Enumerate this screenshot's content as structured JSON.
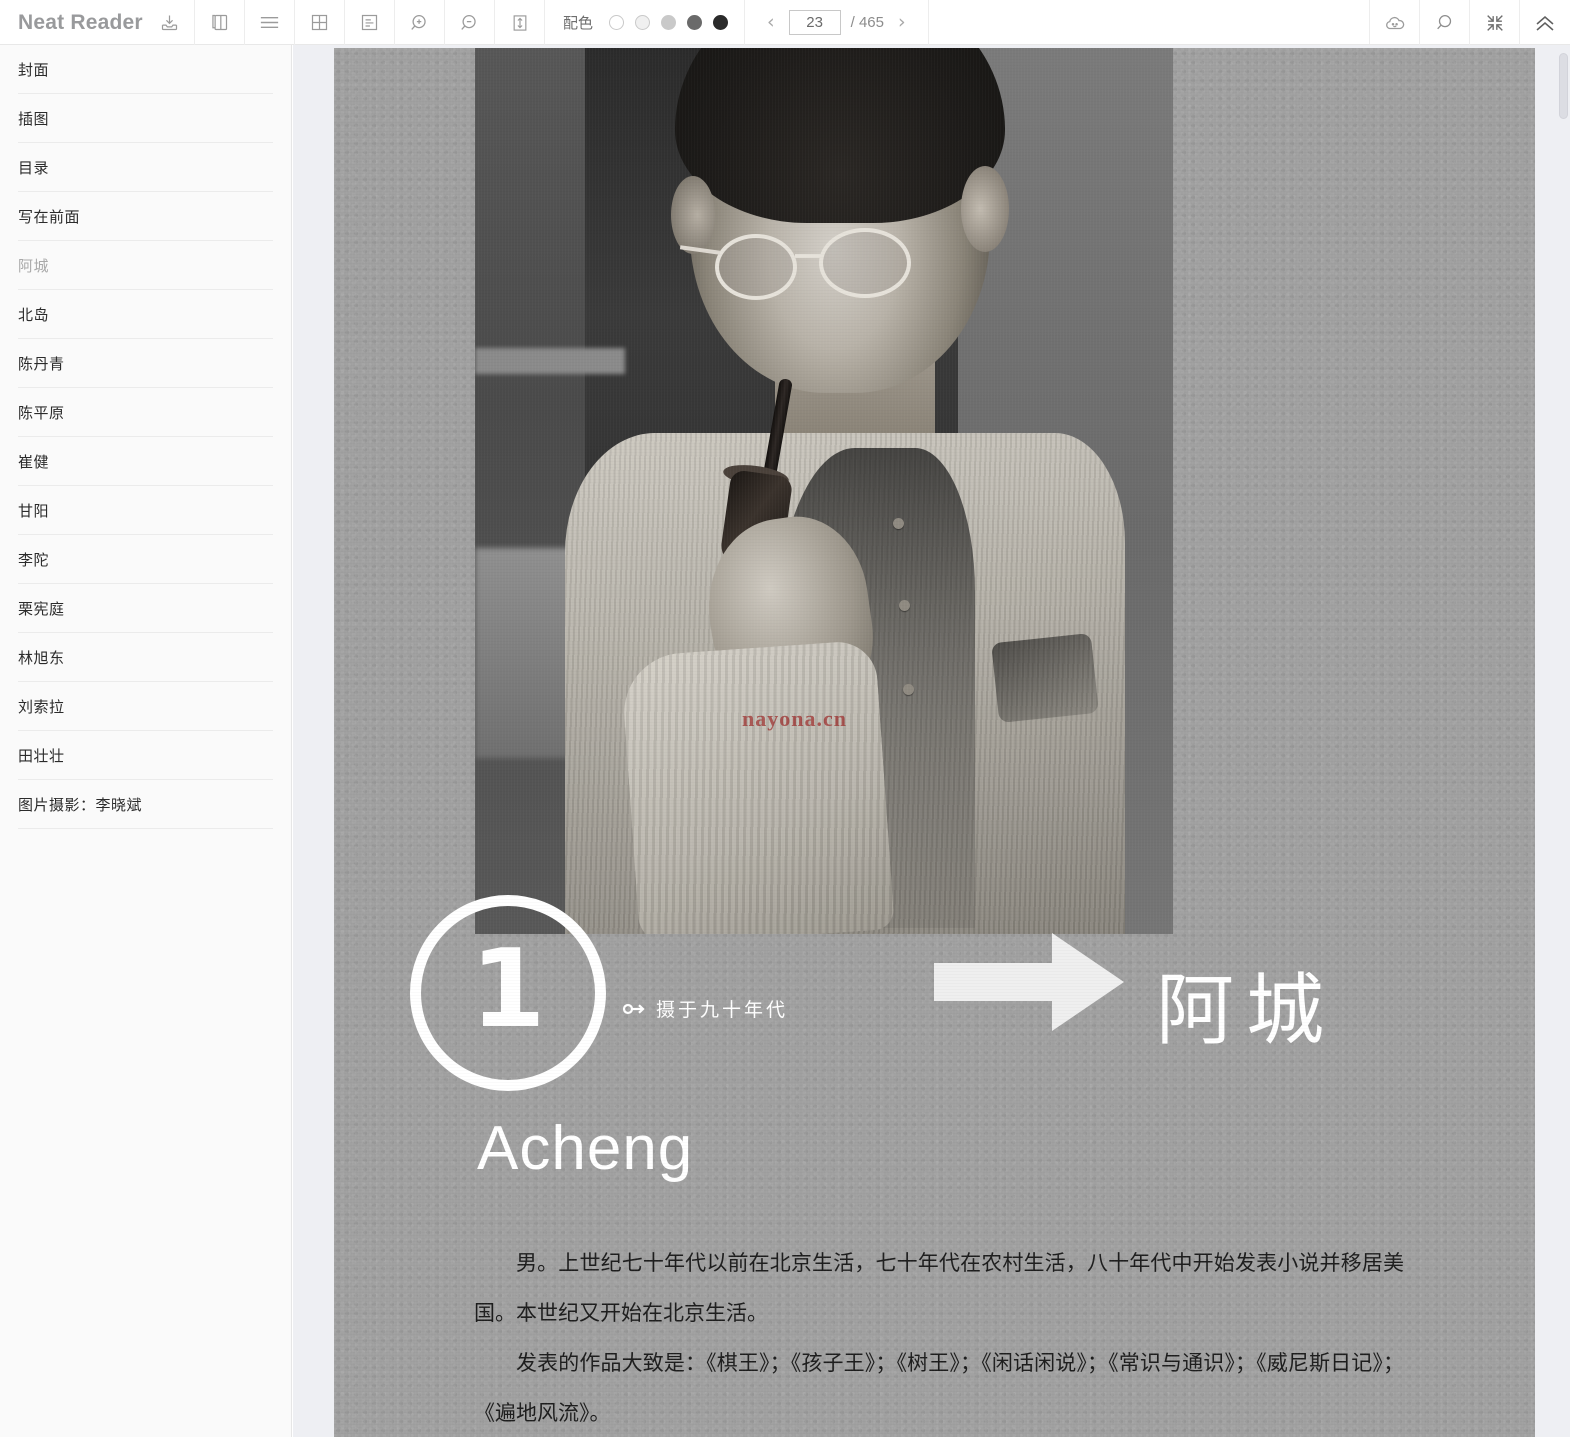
{
  "app": {
    "name": "Neat Reader"
  },
  "toolbar": {
    "icons": [
      {
        "name": "import-icon",
        "title": "import"
      },
      {
        "name": "duplicate-page-icon",
        "title": "two-page"
      },
      {
        "name": "hamburger-menu-icon",
        "title": "menu"
      },
      {
        "name": "grid-layout-icon",
        "title": "grid"
      },
      {
        "name": "text-layout-icon",
        "title": "text layout"
      },
      {
        "name": "zoom-in-icon",
        "title": "zoom in"
      },
      {
        "name": "zoom-out-icon",
        "title": "zoom out"
      },
      {
        "name": "fit-height-icon",
        "title": "fit height"
      }
    ],
    "palette": {
      "label": "配色",
      "swatches": [
        "#ffffff",
        "#f0f0f0",
        "#c9c9c9",
        "#6a6a6a",
        "#2b2b2b"
      ],
      "selected_index": 0
    },
    "pager": {
      "prev_label": "‹",
      "next_label": "›",
      "current_page": "23",
      "total_label": "/ 465",
      "total_pages": 465
    },
    "right_icons": [
      {
        "name": "cloud-icon",
        "title": "cloud sync"
      },
      {
        "name": "search-icon",
        "title": "search"
      },
      {
        "name": "collapse-icon",
        "title": "collapse"
      },
      {
        "name": "chevron-double-up-icon",
        "title": "scroll to top"
      }
    ]
  },
  "sidebar": {
    "items": [
      {
        "label": "封面",
        "active": false
      },
      {
        "label": "插图",
        "active": false
      },
      {
        "label": "目录",
        "active": false
      },
      {
        "label": "写在前面",
        "active": false
      },
      {
        "label": "阿城",
        "active": true
      },
      {
        "label": "北岛",
        "active": false
      },
      {
        "label": "陈丹青",
        "active": false
      },
      {
        "label": "陈平原",
        "active": false
      },
      {
        "label": "崔健",
        "active": false
      },
      {
        "label": "甘阳",
        "active": false
      },
      {
        "label": "李陀",
        "active": false
      },
      {
        "label": "栗宪庭",
        "active": false
      },
      {
        "label": "林旭东",
        "active": false
      },
      {
        "label": "刘索拉",
        "active": false
      },
      {
        "label": "田壮壮",
        "active": false
      },
      {
        "label": "图片摄影：李晓斌",
        "active": false
      }
    ]
  },
  "page_content": {
    "chapter_number": "1",
    "photo_caption": "摄于九十年代",
    "name_cn": "阿城",
    "name_en": "Acheng",
    "watermark": "nayona.cn",
    "paragraphs": [
      "男。上世纪七十年代以前在北京生活，七十年代在农村生活，八十年代中开始发表小说并移居美国。本世纪又开始在北京生活。",
      "发表的作品大致是：《棋王》；《孩子王》；《树王》；《闲话闲说》；《常识与通识》；《威尼斯日记》；《遍地风流》。"
    ]
  },
  "colors": {
    "page_paper": "#a0a0a0",
    "reader_background": "#eeeff3",
    "sidebar_background": "#fafafa",
    "brand_text": "#999a9c",
    "watermark_red": "#961414",
    "active_toc": "#a9a9a9"
  }
}
